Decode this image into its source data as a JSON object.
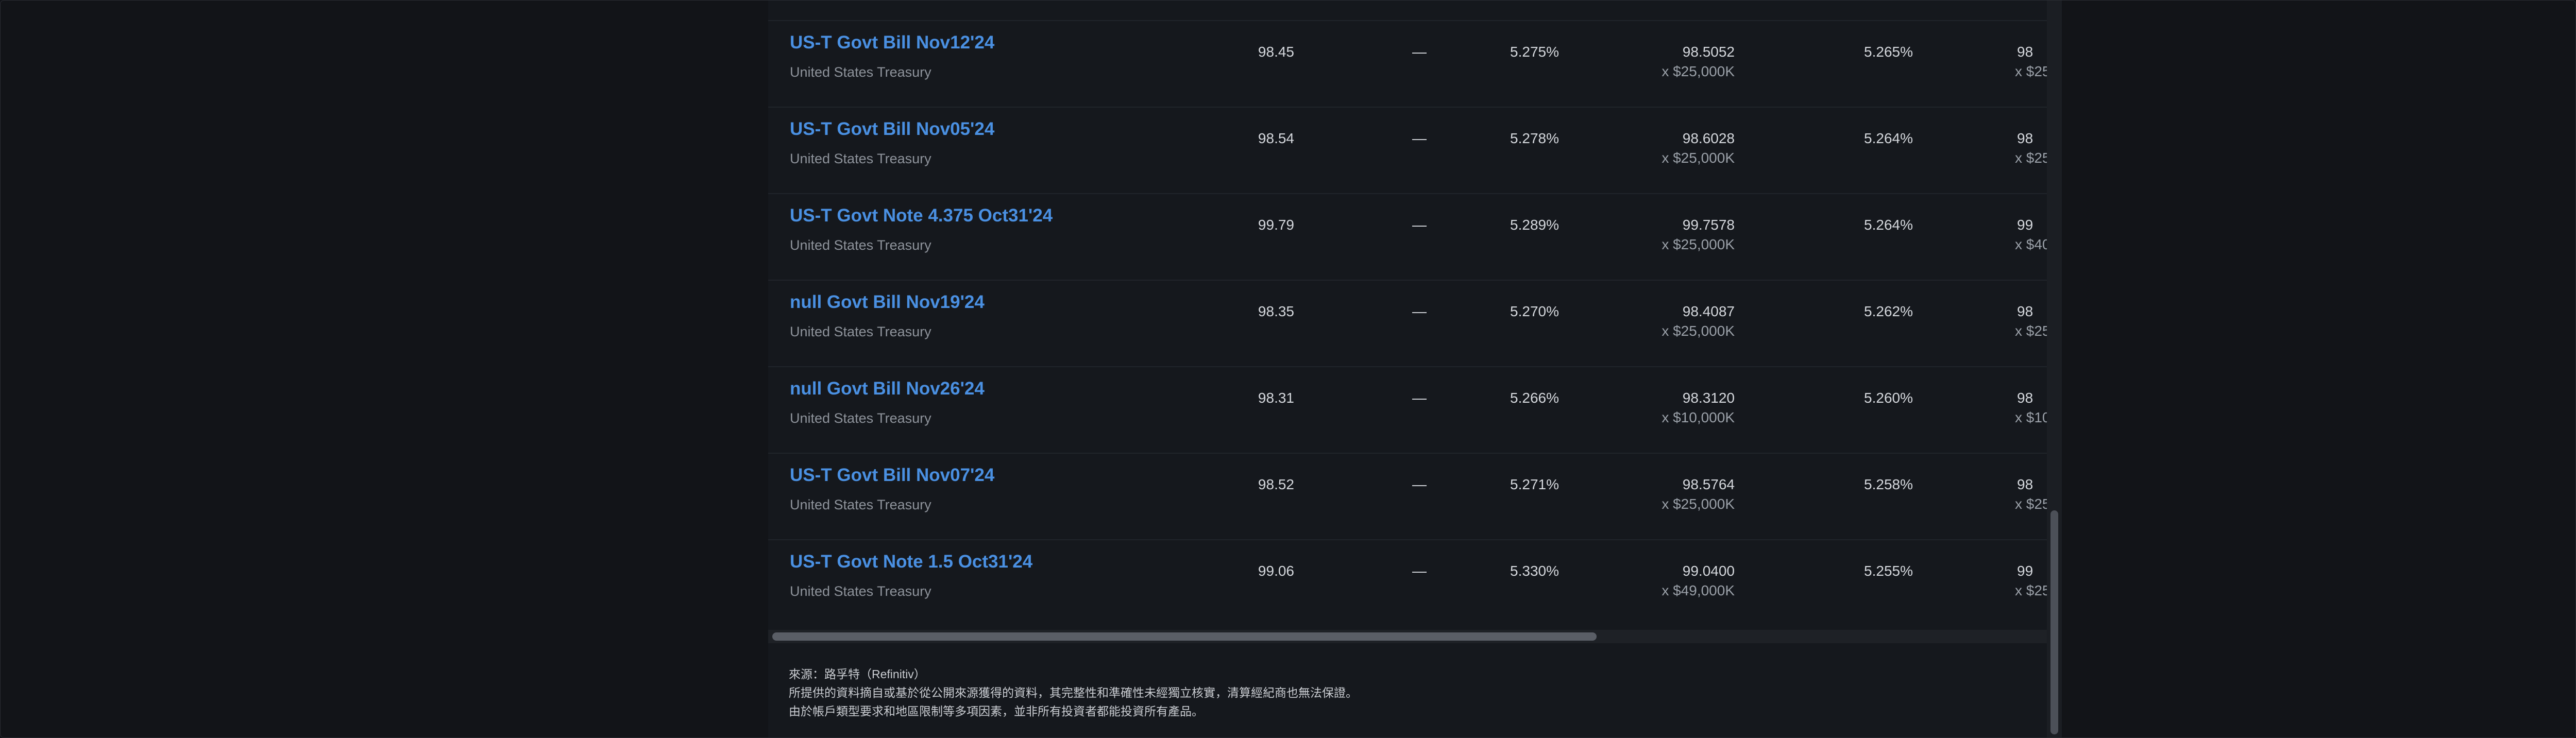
{
  "table": {
    "rows": [
      {
        "name": "US-T Govt Bill Nov12'24",
        "issuer": "United States Treasury",
        "last": "98.45",
        "change": "—",
        "yield1": "5.275%",
        "price2": "98.5052",
        "qty2": "x $25,000K",
        "yield2": "5.265%",
        "price3_partial": "98",
        "qty3_partial": "x $25"
      },
      {
        "name": "US-T Govt Bill Nov05'24",
        "issuer": "United States Treasury",
        "last": "98.54",
        "change": "—",
        "yield1": "5.278%",
        "price2": "98.6028",
        "qty2": "x $25,000K",
        "yield2": "5.264%",
        "price3_partial": "98",
        "qty3_partial": "x $25"
      },
      {
        "name": "US-T Govt Note 4.375 Oct31'24",
        "issuer": "United States Treasury",
        "last": "99.79",
        "change": "—",
        "yield1": "5.289%",
        "price2": "99.7578",
        "qty2": "x $25,000K",
        "yield2": "5.264%",
        "price3_partial": "99",
        "qty3_partial": "x $40"
      },
      {
        "name": "null Govt Bill Nov19'24",
        "issuer": "United States Treasury",
        "last": "98.35",
        "change": "—",
        "yield1": "5.270%",
        "price2": "98.4087",
        "qty2": "x $25,000K",
        "yield2": "5.262%",
        "price3_partial": "98",
        "qty3_partial": "x $25"
      },
      {
        "name": "null Govt Bill Nov26'24",
        "issuer": "United States Treasury",
        "last": "98.31",
        "change": "—",
        "yield1": "5.266%",
        "price2": "98.3120",
        "qty2": "x $10,000K",
        "yield2": "5.260%",
        "price3_partial": "98",
        "qty3_partial": "x $10"
      },
      {
        "name": "US-T Govt Bill Nov07'24",
        "issuer": "United States Treasury",
        "last": "98.52",
        "change": "—",
        "yield1": "5.271%",
        "price2": "98.5764",
        "qty2": "x $25,000K",
        "yield2": "5.258%",
        "price3_partial": "98",
        "qty3_partial": "x $25"
      },
      {
        "name": "US-T Govt Note 1.5 Oct31'24",
        "issuer": "United States Treasury",
        "last": "99.06",
        "change": "—",
        "yield1": "5.330%",
        "price2": "99.0400",
        "qty2": "x $49,000K",
        "yield2": "5.255%",
        "price3_partial": "99",
        "qty3_partial": "x $25"
      }
    ]
  },
  "footer": {
    "source": "來源：路孚特（Refinitiv）",
    "disclaimer_1": "所提供的資料摘自或基於從公開來源獲得的資料，其完整性和準確性未經獨立核實，清算經紀商也無法保證。",
    "disclaimer_2": "由於帳戶類型要求和地區限制等多項因素，並非所有投資者都能投資所有產品。"
  },
  "colors": {
    "background": "#121418",
    "panel": "#15181d",
    "link": "#4a90e2",
    "text": "#d5d8dd",
    "muted": "#8e939b"
  }
}
